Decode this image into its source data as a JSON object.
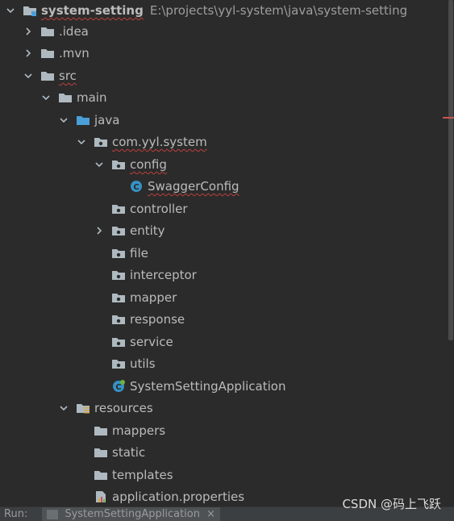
{
  "tree": {
    "root": {
      "name": "system-setting",
      "path": "E:\\projects\\yyl-system\\java\\system-setting"
    },
    "idea": ".idea",
    "mvn": ".mvn",
    "src": "src",
    "main": "main",
    "java": "java",
    "package": "com.yyl.system",
    "config": "config",
    "swagger_config": "SwaggerConfig",
    "controller": "controller",
    "entity": "entity",
    "file": "file",
    "interceptor": "interceptor",
    "mapper": "mapper",
    "response": "response",
    "service": "service",
    "utils": "utils",
    "app_class": "SystemSettingApplication",
    "resources": "resources",
    "mappers": "mappers",
    "static": "static",
    "templates": "templates",
    "app_props": "application.properties"
  },
  "bottom_bar": {
    "run_label": "Run:",
    "run_tab_label": "SystemSettingApplication",
    "close_symbol": "×"
  },
  "watermark": "CSDN @码上飞跃",
  "colors": {
    "background": "#2b2b2b",
    "folder": "#aeb9c0",
    "source_folder": "#4a9fd8",
    "class_icon": "#3592c4",
    "squiggle": "#bc3f3c"
  },
  "icons": {
    "expanded": "chevron-down-icon",
    "collapsed": "chevron-right-icon",
    "folder": "folder-icon",
    "package": "package-icon",
    "class": "class-icon",
    "spring_boot_class": "spring-boot-class-icon",
    "resources": "resources-folder-icon",
    "properties": "properties-file-icon"
  }
}
